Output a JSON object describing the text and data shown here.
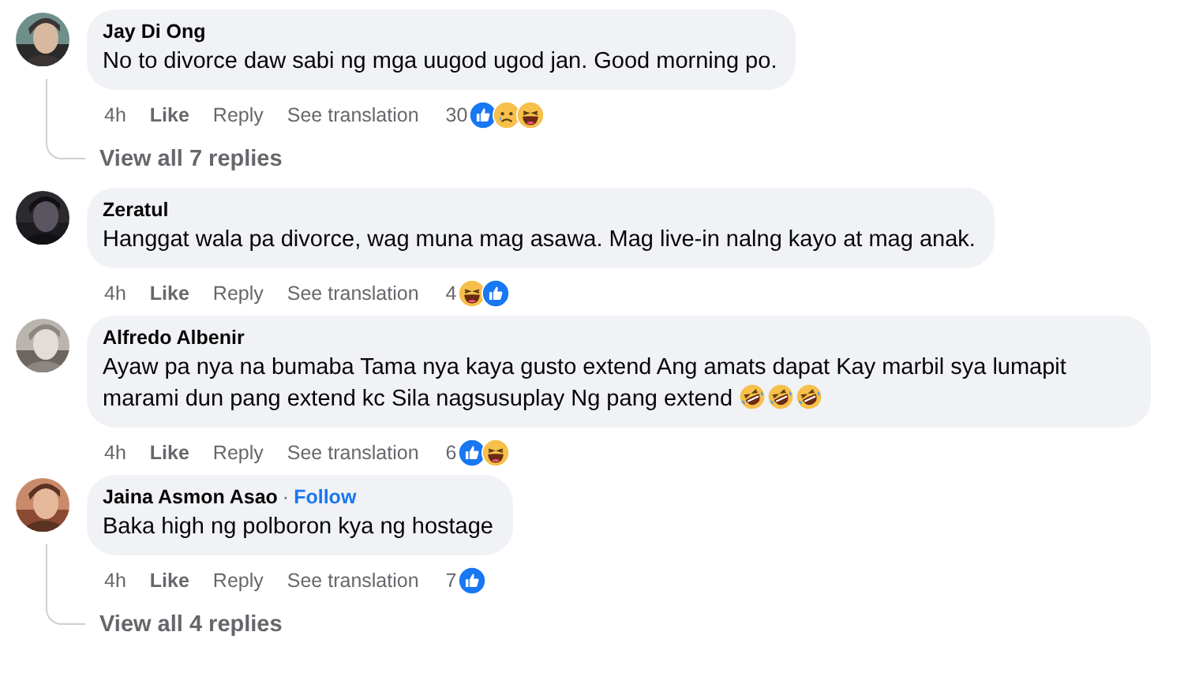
{
  "comments": [
    {
      "author": "Jay Di Ong",
      "text": "No to divorce daw sabi ng mga uugod ugod jan. Good morning po.",
      "time": "4h",
      "actions": [
        {
          "label": "Like",
          "kind": "like"
        },
        {
          "label": "Reply",
          "kind": "reply"
        },
        {
          "label": "See translation",
          "kind": "translate"
        }
      ],
      "reaction_count": "30",
      "reactions": [
        {
          "kind": "like"
        },
        {
          "kind": "sad"
        },
        {
          "kind": "haha"
        }
      ],
      "replies_link": "View all 7 replies"
    },
    {
      "author": "Zeratul",
      "text": "Hanggat wala pa divorce, wag muna mag asawa. Mag live-in nalng kayo at mag anak.",
      "time": "4h",
      "actions": [
        {
          "label": "Like",
          "kind": "like"
        },
        {
          "label": "Reply",
          "kind": "reply"
        },
        {
          "label": "See translation",
          "kind": "translate"
        }
      ],
      "reaction_count": "4",
      "reactions": [
        {
          "kind": "haha"
        },
        {
          "kind": "like"
        }
      ]
    },
    {
      "author": "Alfredo Albenir",
      "text": "Ayaw pa nya na bumaba Tama nya kaya gusto extend Ang amats dapat Kay marbil sya lumapit marami dun pang extend kc Sila nagsusuplay Ng pang extend",
      "text_emojis": [
        {
          "kind": "rofl"
        },
        {
          "kind": "rofl"
        },
        {
          "kind": "rofl"
        }
      ],
      "time": "4h",
      "actions": [
        {
          "label": "Like",
          "kind": "like"
        },
        {
          "label": "Reply",
          "kind": "reply"
        },
        {
          "label": "See translation",
          "kind": "translate"
        }
      ],
      "reaction_count": "6",
      "reactions": [
        {
          "kind": "like"
        },
        {
          "kind": "haha"
        }
      ]
    },
    {
      "author": "Jaina Asmon Asao",
      "follow": {
        "separator": "·",
        "label": "Follow"
      },
      "text": "Baka high ng polboron kya ng hostage",
      "time": "4h",
      "actions": [
        {
          "label": "Like",
          "kind": "like"
        },
        {
          "label": "Reply",
          "kind": "reply"
        },
        {
          "label": "See translation",
          "kind": "translate"
        }
      ],
      "reaction_count": "7",
      "reactions": [
        {
          "kind": "like"
        }
      ],
      "replies_link": "View all 4 replies"
    }
  ]
}
